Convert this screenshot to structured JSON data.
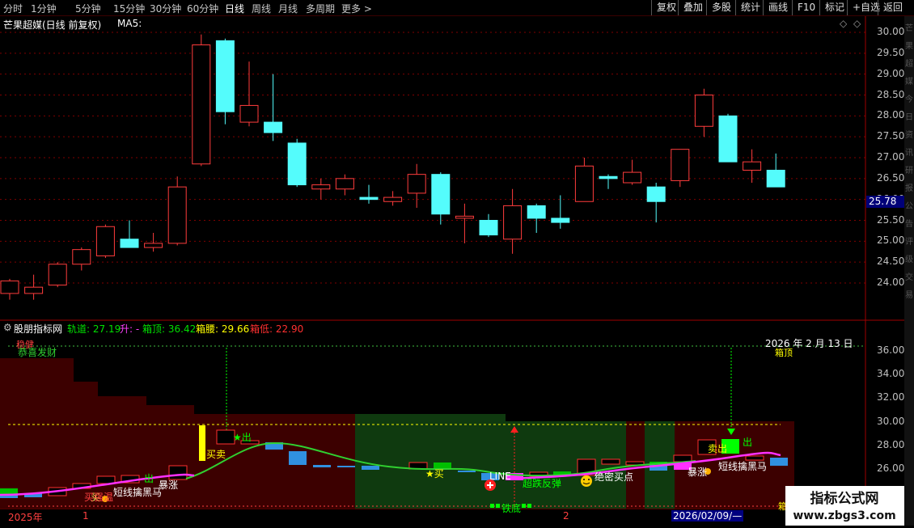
{
  "toolbar": {
    "periods": [
      "分时",
      "1分钟",
      "5分钟",
      "15分钟",
      "30分钟",
      "60分钟",
      "日线",
      "周线",
      "月线",
      "多周期",
      "更多 >"
    ],
    "active_period": "日线",
    "right_buttons": [
      "复权",
      "叠加",
      "多股",
      "统计",
      "画线",
      "F10",
      "标记",
      "+自选",
      "返回"
    ]
  },
  "top_panel": {
    "title": "芒果超媒(日线 前复权)",
    "ma_label": "MA5:",
    "current_price": "25.78",
    "corner_icons": [
      "◇",
      "◇"
    ],
    "y_ticks": [
      "30.00",
      "29.50",
      "29.00",
      "28.50",
      "28.00",
      "27.50",
      "27.00",
      "26.50",
      "26.00",
      "25.50",
      "25.00",
      "24.50",
      "24.00"
    ]
  },
  "bottom_panel": {
    "indicator_name": "股朋指标网",
    "legend": [
      {
        "label": "轨道: 27.19",
        "color": "#00e000"
      },
      {
        "label": "升: -",
        "color": "#ff40ff"
      },
      {
        "label": "箱顶: 36.42",
        "color": "#00e000"
      },
      {
        "label": "箱腰: 29.66",
        "color": "#ffff00"
      },
      {
        "label": "箱低: 22.90",
        "color": "#ff3030"
      }
    ],
    "y_ticks": [
      "36.00",
      "34.00",
      "32.00",
      "30.00",
      "28.00",
      "26.00"
    ],
    "date_annotation": "2026 年 2 月 13 日",
    "tag_box_top": "箱顶",
    "tag_box_bottom": "箱",
    "left_tags": [
      "稳健",
      "恭喜发财"
    ],
    "signals": [
      {
        "text": "买",
        "color": "#ffff60"
      },
      {
        "text": "暴涨",
        "color": "#ffffff"
      },
      {
        "text": "出",
        "color": "#00ff00"
      },
      {
        "text": "买强温",
        "color": "#ff4040"
      },
      {
        "text": "短线擒黑马",
        "color": "#ffffff"
      },
      {
        "text": "买卖",
        "color": "#ffff00"
      },
      {
        "text": "★出",
        "color": "#00ff00"
      },
      {
        "text": "★买",
        "color": "#ffff00"
      },
      {
        "text": "LINE",
        "color": "#ffffff"
      },
      {
        "text": "超跌反弹",
        "color": "#00ff00"
      },
      {
        "text": "绝密买点",
        "color": "#ffffff"
      },
      {
        "text": "铁底",
        "color": "#00ff00"
      },
      {
        "text": "暴涨",
        "color": "#ffffff"
      },
      {
        "text": "卖出",
        "color": "#ffff00"
      },
      {
        "text": "出",
        "color": "#00ff00"
      },
      {
        "text": "短线擒黑马",
        "color": "#ffffff"
      }
    ],
    "x_axis": {
      "labels": [
        "2025年",
        "1",
        "2"
      ],
      "cursor_date": "2026/02/09/—"
    }
  },
  "side_text": "芒果超媒今日资讯研报公告评级交易",
  "chart_data": {
    "type": "candlestick",
    "title": "芒果超媒(日线 前复权)",
    "ylim": [
      23.6,
      30.3
    ],
    "candles": [
      {
        "o": 23.75,
        "h": 24.1,
        "l": 23.6,
        "c": 24.05
      },
      {
        "o": 23.75,
        "h": 24.2,
        "l": 23.6,
        "c": 23.9
      },
      {
        "o": 23.95,
        "h": 24.5,
        "l": 23.9,
        "c": 24.45
      },
      {
        "o": 24.45,
        "h": 24.85,
        "l": 24.3,
        "c": 24.8
      },
      {
        "o": 24.65,
        "h": 25.4,
        "l": 24.6,
        "c": 25.35
      },
      {
        "o": 25.05,
        "h": 25.5,
        "l": 24.95,
        "c": 24.85
      },
      {
        "o": 24.85,
        "h": 25.2,
        "l": 24.75,
        "c": 24.95
      },
      {
        "o": 24.95,
        "h": 26.55,
        "l": 24.9,
        "c": 26.3
      },
      {
        "o": 26.85,
        "h": 29.95,
        "l": 26.8,
        "c": 29.7
      },
      {
        "o": 29.8,
        "h": 29.85,
        "l": 27.8,
        "c": 28.1
      },
      {
        "o": 27.85,
        "h": 29.3,
        "l": 27.75,
        "c": 28.25
      },
      {
        "o": 27.85,
        "h": 29.0,
        "l": 27.4,
        "c": 27.6
      },
      {
        "o": 27.35,
        "h": 27.45,
        "l": 26.3,
        "c": 26.35
      },
      {
        "o": 26.25,
        "h": 26.5,
        "l": 26.0,
        "c": 26.35
      },
      {
        "o": 26.25,
        "h": 26.6,
        "l": 26.1,
        "c": 26.5
      },
      {
        "o": 26.05,
        "h": 26.35,
        "l": 25.9,
        "c": 26.0
      },
      {
        "o": 25.95,
        "h": 26.2,
        "l": 25.85,
        "c": 26.05
      },
      {
        "o": 26.15,
        "h": 26.85,
        "l": 25.8,
        "c": 26.6
      },
      {
        "o": 26.6,
        "h": 26.65,
        "l": 25.4,
        "c": 25.65
      },
      {
        "o": 25.55,
        "h": 25.9,
        "l": 24.95,
        "c": 25.6
      },
      {
        "o": 25.5,
        "h": 25.65,
        "l": 25.1,
        "c": 25.15
      },
      {
        "o": 25.05,
        "h": 26.25,
        "l": 24.7,
        "c": 25.85
      },
      {
        "o": 25.85,
        "h": 25.9,
        "l": 25.2,
        "c": 25.55
      },
      {
        "o": 25.55,
        "h": 26.1,
        "l": 25.3,
        "c": 25.45
      },
      {
        "o": 25.95,
        "h": 27.0,
        "l": 25.95,
        "c": 26.8
      },
      {
        "o": 26.55,
        "h": 26.6,
        "l": 26.25,
        "c": 26.5
      },
      {
        "o": 26.4,
        "h": 26.95,
        "l": 26.35,
        "c": 26.65
      },
      {
        "o": 26.3,
        "h": 26.4,
        "l": 25.45,
        "c": 25.95
      },
      {
        "o": 26.45,
        "h": 27.1,
        "l": 26.3,
        "c": 27.2
      },
      {
        "o": 27.75,
        "h": 28.65,
        "l": 27.5,
        "c": 28.5
      },
      {
        "o": 28.0,
        "h": 28.05,
        "l": 26.9,
        "c": 26.9
      },
      {
        "o": 26.7,
        "h": 27.2,
        "l": 26.4,
        "c": 26.9
      },
      {
        "o": 26.7,
        "h": 27.1,
        "l": 26.3,
        "c": 26.3
      }
    ]
  }
}
